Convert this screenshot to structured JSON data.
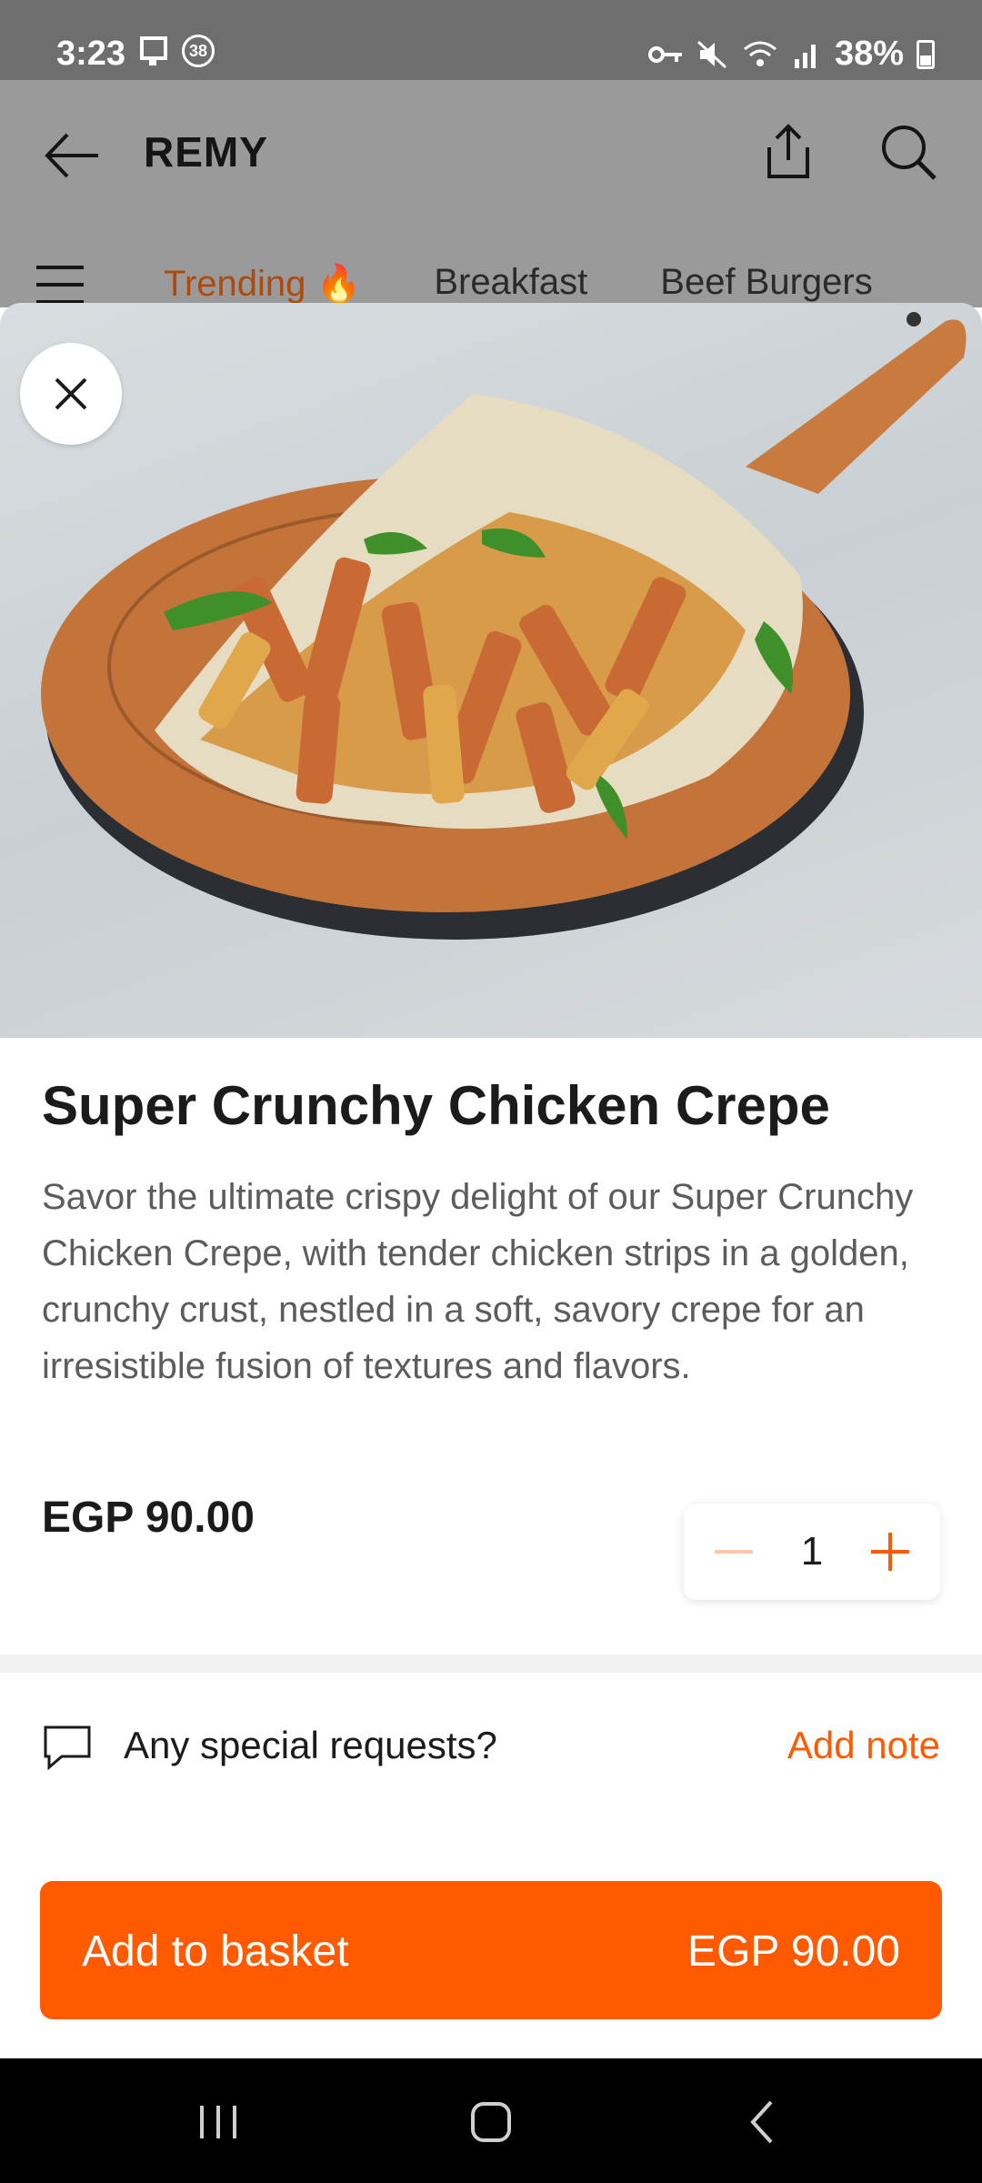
{
  "status_bar": {
    "time": "3:23",
    "notification_count": "38",
    "battery": "38%",
    "icons": [
      "phone-icon",
      "vpn-key-icon",
      "mute-icon",
      "wifi-icon",
      "signal-icon",
      "battery-icon"
    ]
  },
  "header": {
    "title": "REMY",
    "back_icon": "back-arrow-icon",
    "share_icon": "share-icon",
    "search_icon": "search-icon"
  },
  "categories": {
    "menu_icon": "hamburger-menu-icon",
    "tabs": [
      {
        "label": "Trending 🔥",
        "active": true
      },
      {
        "label": "Breakfast",
        "active": false
      },
      {
        "label": "Beef Burgers",
        "active": false
      }
    ]
  },
  "product": {
    "title": "Super Crunchy Chicken Crepe",
    "description": "Savor the ultimate crispy delight of our Super Crunchy Chicken Crepe, with tender chicken strips in a golden, crunchy crust, nestled in a soft, savory crepe for an irresistible fusion of textures and flavors.",
    "price": "EGP 90.00",
    "quantity": "1"
  },
  "special_requests": {
    "label": "Any special requests?",
    "action": "Add note"
  },
  "basket_button": {
    "label": "Add to basket",
    "price": "EGP 90.00"
  },
  "colors": {
    "accent": "#ff5a00",
    "accent_light": "#ffc7a8",
    "status_bar": "#6e6e6e",
    "nav_bar": "#000000"
  }
}
